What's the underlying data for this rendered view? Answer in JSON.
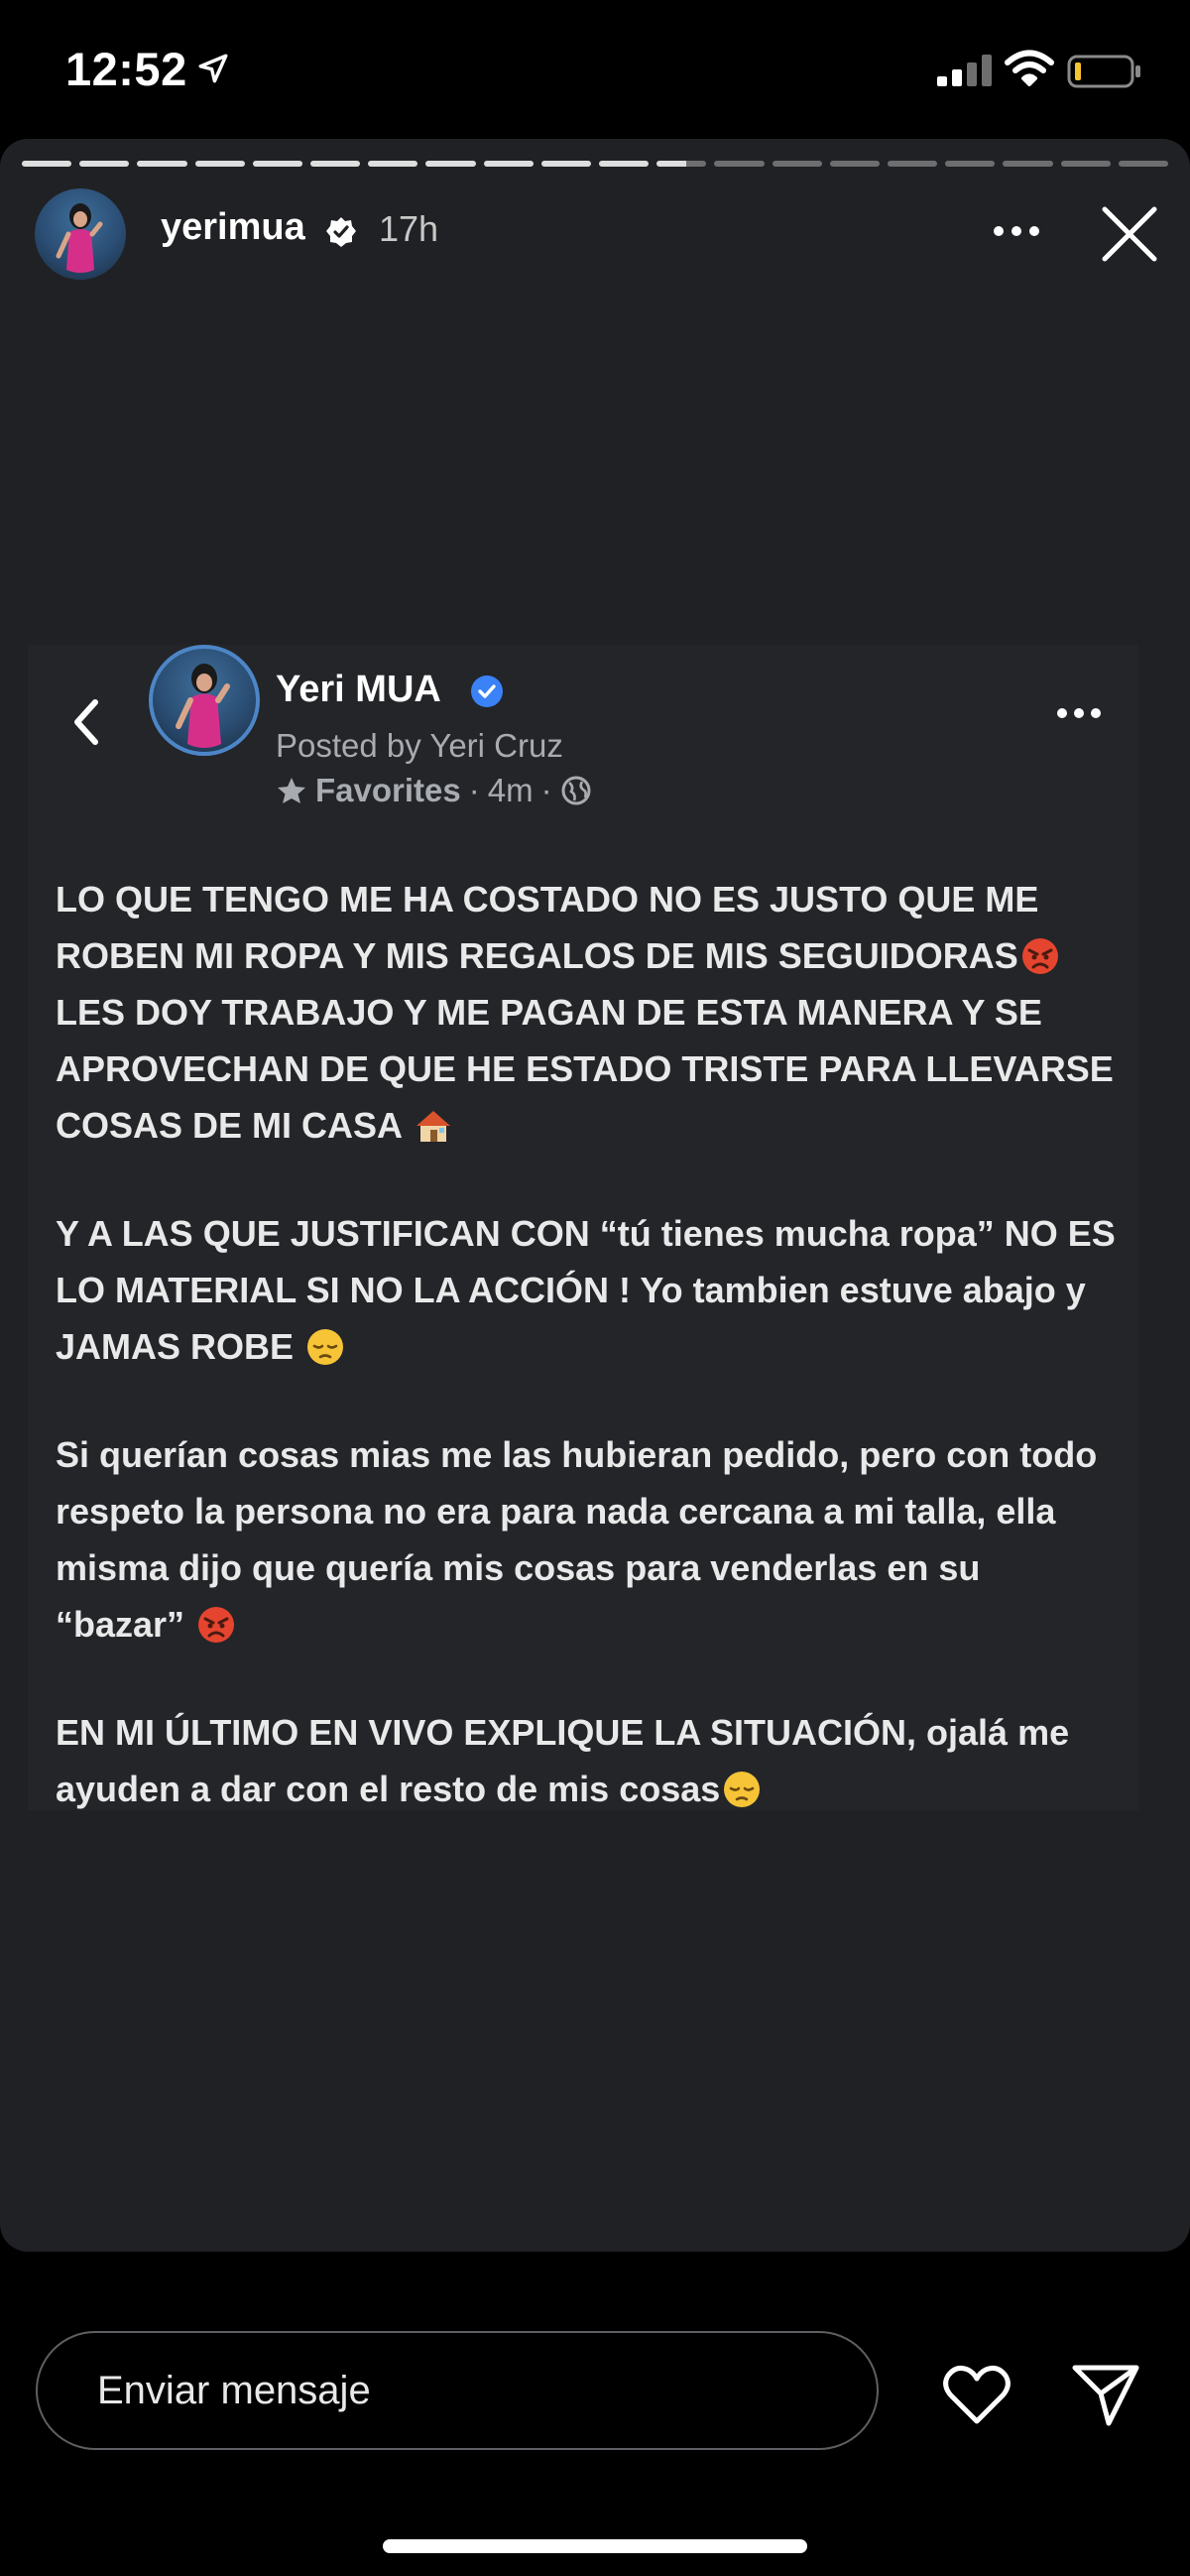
{
  "status_bar": {
    "time": "12:52",
    "icons": [
      "location-arrow-icon",
      "cellular-signal-icon",
      "wifi-icon",
      "battery-icon"
    ]
  },
  "story": {
    "progress": {
      "segments": 20,
      "current_index": 11,
      "current_fraction": 0.6
    },
    "username": "yerimua",
    "verified": true,
    "time_ago": "17h"
  },
  "post": {
    "page_name": "Yeri MUA",
    "verified": true,
    "posted_by": "Posted by Yeri Cruz",
    "audience": "Favorites",
    "time": "4m",
    "separator": "·",
    "paragraphs": [
      {
        "text": "LO QUE TENGO ME HA COSTADO NO ES JUSTO QUE ME ROBEN MI ROPA Y MIS REGALOS DE MIS SEGUIDORAS",
        "emoji": "angry",
        "continuation": " LES DOY TRABAJO Y ME PAGAN DE ESTA MANERA Y SE APROVECHAN DE QUE HE ESTADO TRISTE PARA LLEVARSE COSAS DE MI CASA ",
        "end_emoji": "house"
      },
      {
        "text": "Y A LAS QUE JUSTIFICAN CON “tú tienes mucha ropa” NO ES LO MATERIAL SI NO LA ACCIÓN ! Yo tambien estuve abajo y JAMAS ROBE ",
        "end_emoji": "pensive"
      },
      {
        "text": "Si querían cosas mias me las hubieran pedido, pero con todo respeto la persona no era para nada cercana a mi talla, ella misma dijo que quería mis cosas para venderlas en su “bazar” ",
        "end_emoji": "angry"
      },
      {
        "text": "EN MI ÚLTIMO EN VIVO EXPLIQUE LA SITUACIÓN, ojalá me ayuden a dar con el resto de mis cosas",
        "end_emoji": "pensive"
      }
    ]
  },
  "footer": {
    "message_placeholder": "Enviar mensaje",
    "icons": [
      "heart-icon",
      "send-icon"
    ]
  },
  "colors": {
    "background": "#000000",
    "story_panel": "#202124",
    "post_panel": "#232529",
    "verified_blue": "#3b82f6",
    "muted_text": "#a8abb0"
  }
}
